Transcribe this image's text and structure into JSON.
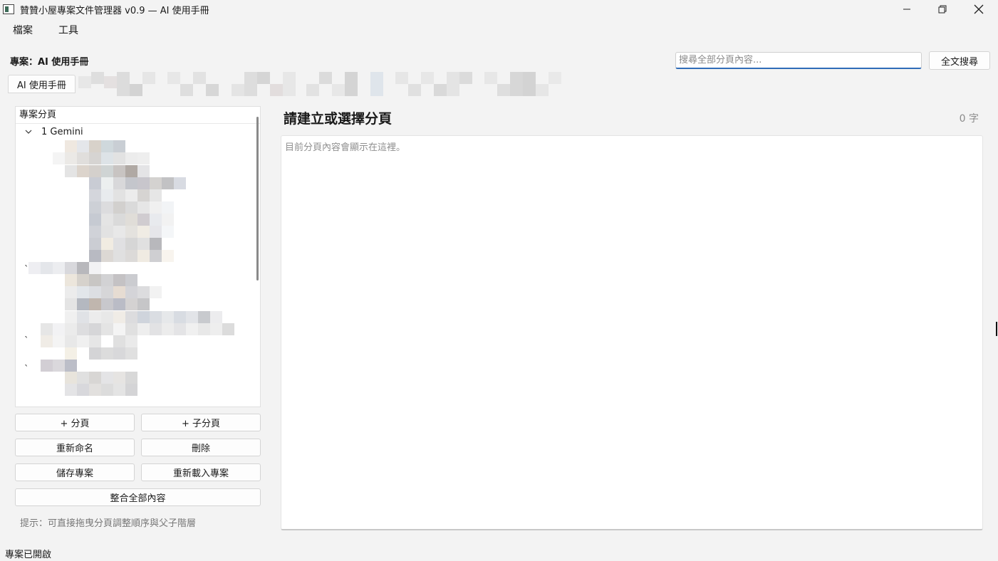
{
  "window": {
    "title": "贊贊小屋專案文件管理器 v0.9 — AI 使用手冊",
    "controls": {
      "minimize": "minimize-icon",
      "maximize": "restore-icon",
      "close": "close-icon"
    }
  },
  "menu": {
    "items": [
      "檔案",
      "工具"
    ]
  },
  "header": {
    "project_label": "專案：AI 使用手冊",
    "search_placeholder": "搜尋全部分頁內容...",
    "search_button": "全文搜尋"
  },
  "tabs": {
    "active": "AI 使用手冊"
  },
  "tree": {
    "header": "專案分頁",
    "root_label": "1 Gemini",
    "ticks": [
      "`",
      "`",
      "`"
    ]
  },
  "buttons": {
    "add_page": "+ 分頁",
    "add_subpage": "+ 子分頁",
    "rename": "重新命名",
    "delete": "刪除",
    "save_project": "儲存專案",
    "reload_project": "重新載入專案",
    "merge_all": "整合全部內容"
  },
  "hint": "提示：可直接拖曳分頁調整順序與父子階層",
  "editor": {
    "title": "請建立或選擇分頁",
    "char_count": "0 字",
    "placeholder": "目前分頁內容會顯示在這裡。"
  },
  "status_bar": "專案已開啟",
  "colors": {
    "accent": "#2f6cb8",
    "background": "#f3f3f3"
  }
}
